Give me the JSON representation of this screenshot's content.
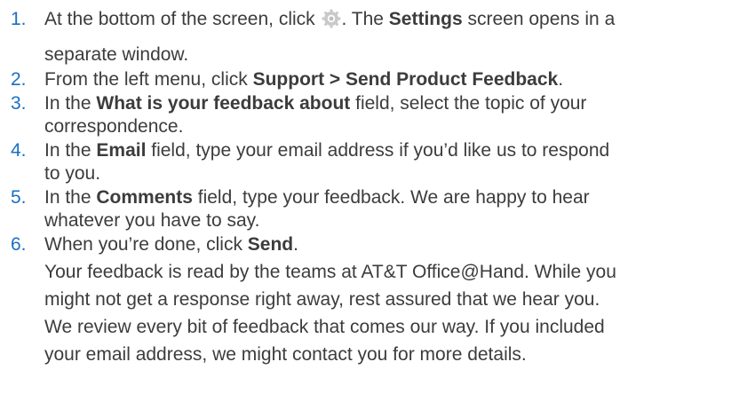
{
  "steps": [
    {
      "num": "1.",
      "pre": "At the bottom of the screen, click ",
      "icon": "gear-icon",
      "mid": ". The ",
      "bold1": "Settings",
      "post": " screen opens in a",
      "line2": "separate window."
    },
    {
      "num": "2.",
      "pre": "From the left menu, click ",
      "bold1": "Support > Send Product Feedback",
      "post": "."
    },
    {
      "num": "3.",
      "pre": "In the ",
      "bold1": "What is your feedback about",
      "post": " field, select the topic of your",
      "line2": "correspondence."
    },
    {
      "num": "4.",
      "pre": "In the ",
      "bold1": "Email",
      "post": " field, type your email address if you’d like us to respond",
      "line2": "to you."
    },
    {
      "num": "5.",
      "pre": "In the ",
      "bold1": "Comments",
      "post": " field, type your feedback. We are happy to hear",
      "line2": "whatever you have to say."
    },
    {
      "num": "6.",
      "pre": "When you’re done, click ",
      "bold1": "Send",
      "post": ".",
      "note_lines": [
        "Your feedback is read by the teams at AT&T Office@Hand. While you",
        "might not get a response right away, rest assured that we hear you.",
        "We review every bit of feedback that comes our way. If you included",
        "your email address, we might contact you for more details."
      ]
    }
  ]
}
